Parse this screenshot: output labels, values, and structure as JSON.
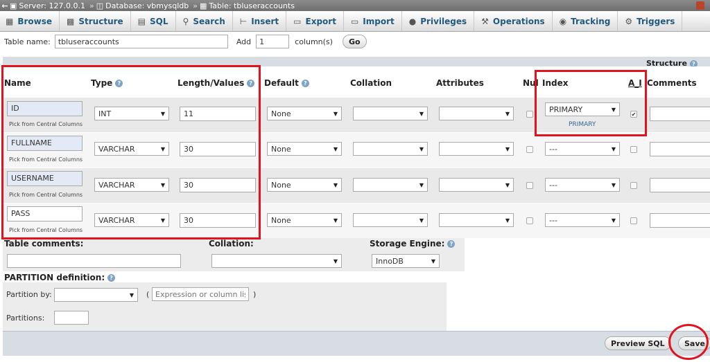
{
  "breadcrumb": {
    "server": "Server: 127.0.0.1",
    "database": "Database: vbmysqldb",
    "table": "Table: tbluseraccounts"
  },
  "tabs": [
    {
      "label": "Browse",
      "icon": "table-icon"
    },
    {
      "label": "Structure",
      "icon": "structure-icon"
    },
    {
      "label": "SQL",
      "icon": "sql-icon"
    },
    {
      "label": "Search",
      "icon": "search-icon"
    },
    {
      "label": "Insert",
      "icon": "insert-icon"
    },
    {
      "label": "Export",
      "icon": "export-icon"
    },
    {
      "label": "Import",
      "icon": "import-icon"
    },
    {
      "label": "Privileges",
      "icon": "privileges-icon"
    },
    {
      "label": "Operations",
      "icon": "wrench-icon"
    },
    {
      "label": "Tracking",
      "icon": "eye-icon"
    },
    {
      "label": "Triggers",
      "icon": "triggers-icon"
    }
  ],
  "table_name": {
    "label": "Table name:",
    "value": "tbluseraccounts",
    "add_label": "Add",
    "add_value": "1",
    "columns_label": "column(s)",
    "go_label": "Go"
  },
  "structure_label": "Structure",
  "headers": {
    "name": "Name",
    "type": "Type",
    "length": "Length/Values",
    "default": "Default",
    "collation": "Collation",
    "attributes": "Attributes",
    "null": "Null",
    "index": "Index",
    "ai": "A_I",
    "comments": "Comments"
  },
  "pick_label": "Pick from Central Columns",
  "columns": [
    {
      "name": "ID",
      "type": "INT",
      "length": "11",
      "default": "None",
      "index": "PRIMARY",
      "index_note": "PRIMARY",
      "ai": true
    },
    {
      "name": "FULLNAME",
      "type": "VARCHAR",
      "length": "30",
      "default": "None",
      "index": "---",
      "index_note": "",
      "ai": false
    },
    {
      "name": "USERNAME",
      "type": "VARCHAR",
      "length": "30",
      "default": "None",
      "index": "---",
      "index_note": "",
      "ai": false
    },
    {
      "name": "PASS",
      "type": "VARCHAR",
      "length": "30",
      "default": "None",
      "index": "---",
      "index_note": "",
      "ai": false
    }
  ],
  "footer": {
    "table_comments_label": "Table comments:",
    "collation_label": "Collation:",
    "storage_engine_label": "Storage Engine:",
    "storage_engine_value": "InnoDB",
    "partition_label": "PARTITION definition:",
    "partition_by_label": "Partition by:",
    "expression_placeholder": "Expression or column list",
    "partitions_label": "Partitions:",
    "paren_open": "(",
    "paren_close": ")",
    "preview_sql_label": "Preview SQL",
    "save_label": "Save"
  },
  "colors": {
    "highlight_red": "#e0141f",
    "link_blue": "#235a81"
  }
}
